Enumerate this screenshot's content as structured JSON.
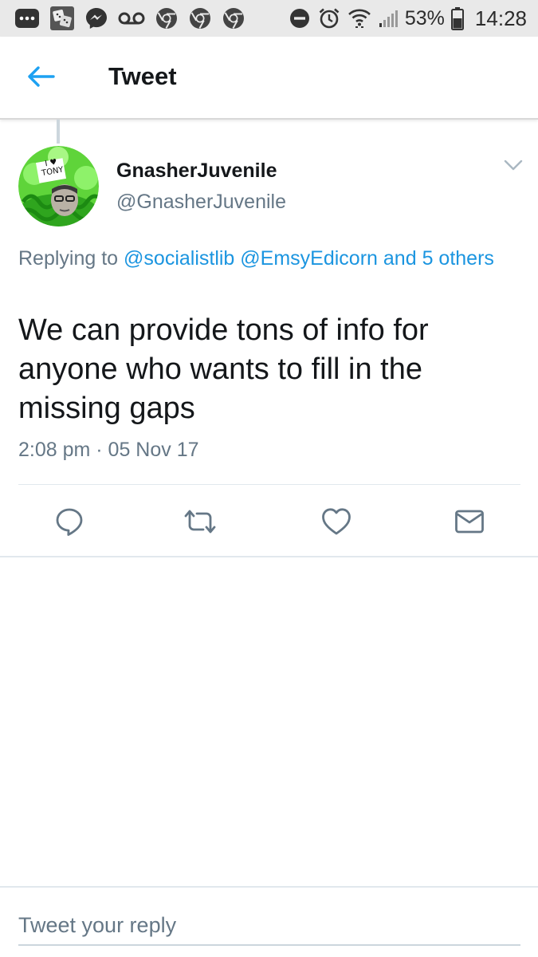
{
  "status_bar": {
    "icons": [
      "more-dots-icon",
      "dice-app-icon",
      "messenger-icon",
      "voicemail-icon",
      "chrome-icon",
      "chrome-icon",
      "chrome-icon",
      "do-not-disturb-icon",
      "alarm-icon",
      "wifi-icon",
      "signal-icon",
      "battery-icon"
    ],
    "battery": "53%",
    "time": "14:28"
  },
  "header": {
    "title": "Tweet",
    "back_icon": "arrow-left-icon"
  },
  "tweet": {
    "display_name": "GnasherJuvenile",
    "handle": "@GnasherJuvenile",
    "avatar_text": "I ♥ TONY",
    "replying_prefix": "Replying to",
    "reply_mentions": [
      "@socialistlib",
      "@EmsyEdicorn"
    ],
    "reply_others": "and 5 others",
    "text": "We can provide tons of info for anyone who wants to fill in the missing gaps",
    "timestamp": "2:08 pm · 05 Nov 17"
  },
  "actions": {
    "reply_icon": "reply-icon",
    "retweet_icon": "retweet-icon",
    "like_icon": "heart-icon",
    "dm_icon": "envelope-icon"
  },
  "composer": {
    "placeholder": "Tweet your reply"
  },
  "colors": {
    "link": "#1b95e0",
    "secondary_text": "#657786",
    "status_bar_bg": "#e9e9e9"
  }
}
